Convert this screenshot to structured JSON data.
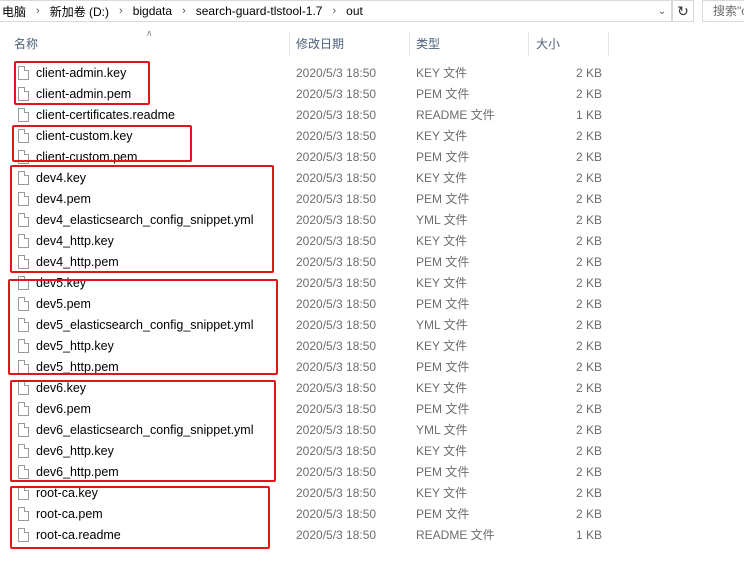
{
  "address": {
    "segments": [
      "电脑",
      "新加卷 (D:)",
      "bigdata",
      "search-guard-tlstool-1.7",
      "out"
    ],
    "separator": "›",
    "dropdown_icon": "chevron-down-icon",
    "refresh_icon": "refresh-icon"
  },
  "search": {
    "placeholder": "搜索\"out\""
  },
  "columns": {
    "name": "名称",
    "date": "修改日期",
    "type": "类型",
    "size": "大小"
  },
  "files": [
    {
      "name": "client-admin.key",
      "date": "2020/5/3 18:50",
      "type": "KEY 文件",
      "size": "2 KB"
    },
    {
      "name": "client-admin.pem",
      "date": "2020/5/3 18:50",
      "type": "PEM 文件",
      "size": "2 KB"
    },
    {
      "name": "client-certificates.readme",
      "date": "2020/5/3 18:50",
      "type": "README 文件",
      "size": "1 KB"
    },
    {
      "name": "client-custom.key",
      "date": "2020/5/3 18:50",
      "type": "KEY 文件",
      "size": "2 KB"
    },
    {
      "name": "client-custom.pem",
      "date": "2020/5/3 18:50",
      "type": "PEM 文件",
      "size": "2 KB"
    },
    {
      "name": "dev4.key",
      "date": "2020/5/3 18:50",
      "type": "KEY 文件",
      "size": "2 KB"
    },
    {
      "name": "dev4.pem",
      "date": "2020/5/3 18:50",
      "type": "PEM 文件",
      "size": "2 KB"
    },
    {
      "name": "dev4_elasticsearch_config_snippet.yml",
      "date": "2020/5/3 18:50",
      "type": "YML 文件",
      "size": "2 KB"
    },
    {
      "name": "dev4_http.key",
      "date": "2020/5/3 18:50",
      "type": "KEY 文件",
      "size": "2 KB"
    },
    {
      "name": "dev4_http.pem",
      "date": "2020/5/3 18:50",
      "type": "PEM 文件",
      "size": "2 KB"
    },
    {
      "name": "dev5.key",
      "date": "2020/5/3 18:50",
      "type": "KEY 文件",
      "size": "2 KB"
    },
    {
      "name": "dev5.pem",
      "date": "2020/5/3 18:50",
      "type": "PEM 文件",
      "size": "2 KB"
    },
    {
      "name": "dev5_elasticsearch_config_snippet.yml",
      "date": "2020/5/3 18:50",
      "type": "YML 文件",
      "size": "2 KB"
    },
    {
      "name": "dev5_http.key",
      "date": "2020/5/3 18:50",
      "type": "KEY 文件",
      "size": "2 KB"
    },
    {
      "name": "dev5_http.pem",
      "date": "2020/5/3 18:50",
      "type": "PEM 文件",
      "size": "2 KB"
    },
    {
      "name": "dev6.key",
      "date": "2020/5/3 18:50",
      "type": "KEY 文件",
      "size": "2 KB"
    },
    {
      "name": "dev6.pem",
      "date": "2020/5/3 18:50",
      "type": "PEM 文件",
      "size": "2 KB"
    },
    {
      "name": "dev6_elasticsearch_config_snippet.yml",
      "date": "2020/5/3 18:50",
      "type": "YML 文件",
      "size": "2 KB"
    },
    {
      "name": "dev6_http.key",
      "date": "2020/5/3 18:50",
      "type": "KEY 文件",
      "size": "2 KB"
    },
    {
      "name": "dev6_http.pem",
      "date": "2020/5/3 18:50",
      "type": "PEM 文件",
      "size": "2 KB"
    },
    {
      "name": "root-ca.key",
      "date": "2020/5/3 18:50",
      "type": "KEY 文件",
      "size": "2 KB"
    },
    {
      "name": "root-ca.pem",
      "date": "2020/5/3 18:50",
      "type": "PEM 文件",
      "size": "2 KB"
    },
    {
      "name": "root-ca.readme",
      "date": "2020/5/3 18:50",
      "type": "README 文件",
      "size": "1 KB"
    }
  ],
  "annotation_color": "#e0161b"
}
